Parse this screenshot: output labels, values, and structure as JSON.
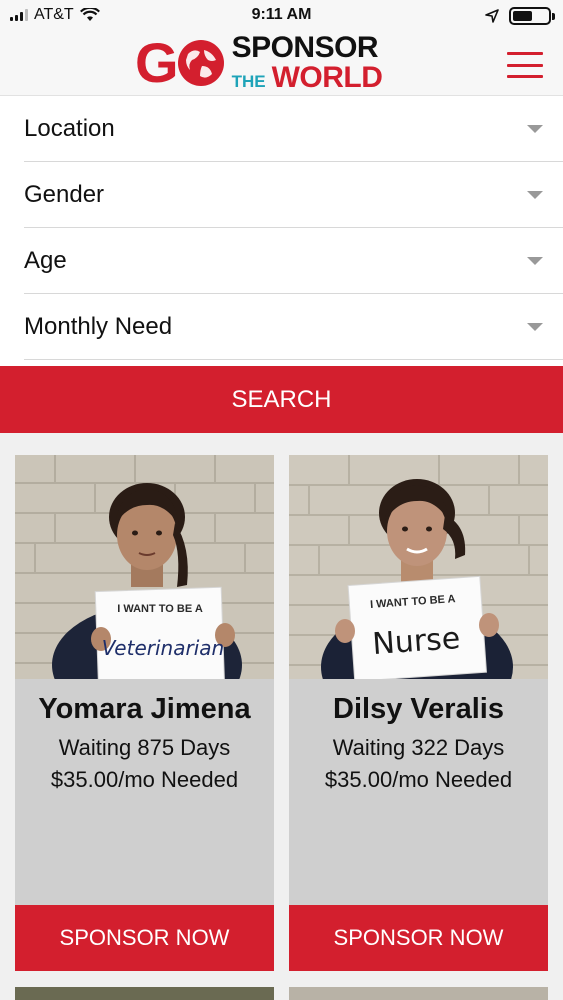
{
  "status_bar": {
    "carrier": "AT&T",
    "time": "9:11 AM",
    "battery_level": 0.55
  },
  "header": {
    "logo": {
      "go": "GO",
      "sponsor": "SPONSOR",
      "the": "THE",
      "world": "WORLD"
    },
    "menu_icon": "hamburger-icon"
  },
  "filters": [
    {
      "label": "Location",
      "icon": "caret-down-icon"
    },
    {
      "label": "Gender",
      "icon": "caret-down-icon"
    },
    {
      "label": "Age",
      "icon": "caret-down-icon"
    },
    {
      "label": "Monthly Need",
      "icon": "caret-down-icon"
    }
  ],
  "search_label": "SEARCH",
  "children": [
    {
      "name": "Yomara Jimena",
      "waiting": "Waiting 875 Days",
      "need": "$35.00/mo Needed",
      "sign_heading": "I WANT TO BE A",
      "sign_text": "Veterinarian",
      "sponsor_label": "SPONSOR NOW"
    },
    {
      "name": "Dilsy Veralis",
      "waiting": "Waiting 322 Days",
      "need": "$35.00/mo Needed",
      "sign_heading": "I WANT TO BE A",
      "sign_text": "Nurse",
      "sponsor_label": "SPONSOR NOW"
    }
  ],
  "colors": {
    "brand_red": "#d31f2e",
    "brand_teal": "#1ea3b8",
    "card_gray": "#cfcfcf"
  }
}
